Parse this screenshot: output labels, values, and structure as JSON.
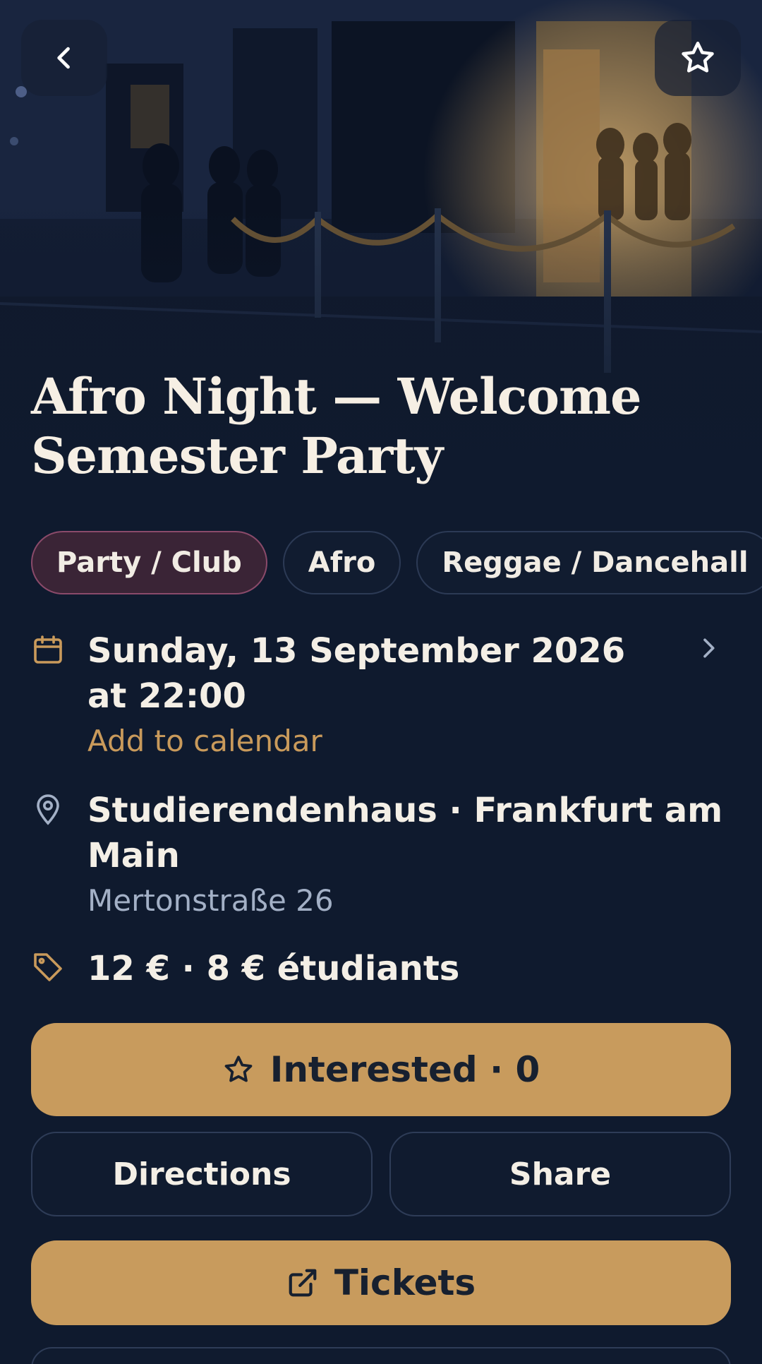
{
  "event": {
    "title": "Afro Night — Welcome Semester Party"
  },
  "tags": [
    "Party / Club",
    "Afro",
    "Reggae / Dancehall"
  ],
  "date": {
    "main": "Sunday, 13 September 2026 at 22:00",
    "action": "Add to calendar"
  },
  "location": {
    "main": "Studierendenhaus · Frankfurt am Main",
    "address": "Mertonstraße 26"
  },
  "price": {
    "main": "12 € · 8 € étudiants"
  },
  "actions": {
    "interested": "Interested · 0",
    "directions": "Directions",
    "share": "Share",
    "tickets": "Tickets"
  },
  "icons": {
    "back": "chevron-left-icon",
    "favorite": "star-icon",
    "date": "calendar-icon",
    "location": "map-pin-icon",
    "price": "tag-icon",
    "interested": "star-icon",
    "tickets": "external-link-icon"
  },
  "colors": {
    "background": "#0f1a2e",
    "accent": "#c89b5d",
    "active_tag": "#3a2436",
    "muted_text": "#a3b0c6"
  }
}
